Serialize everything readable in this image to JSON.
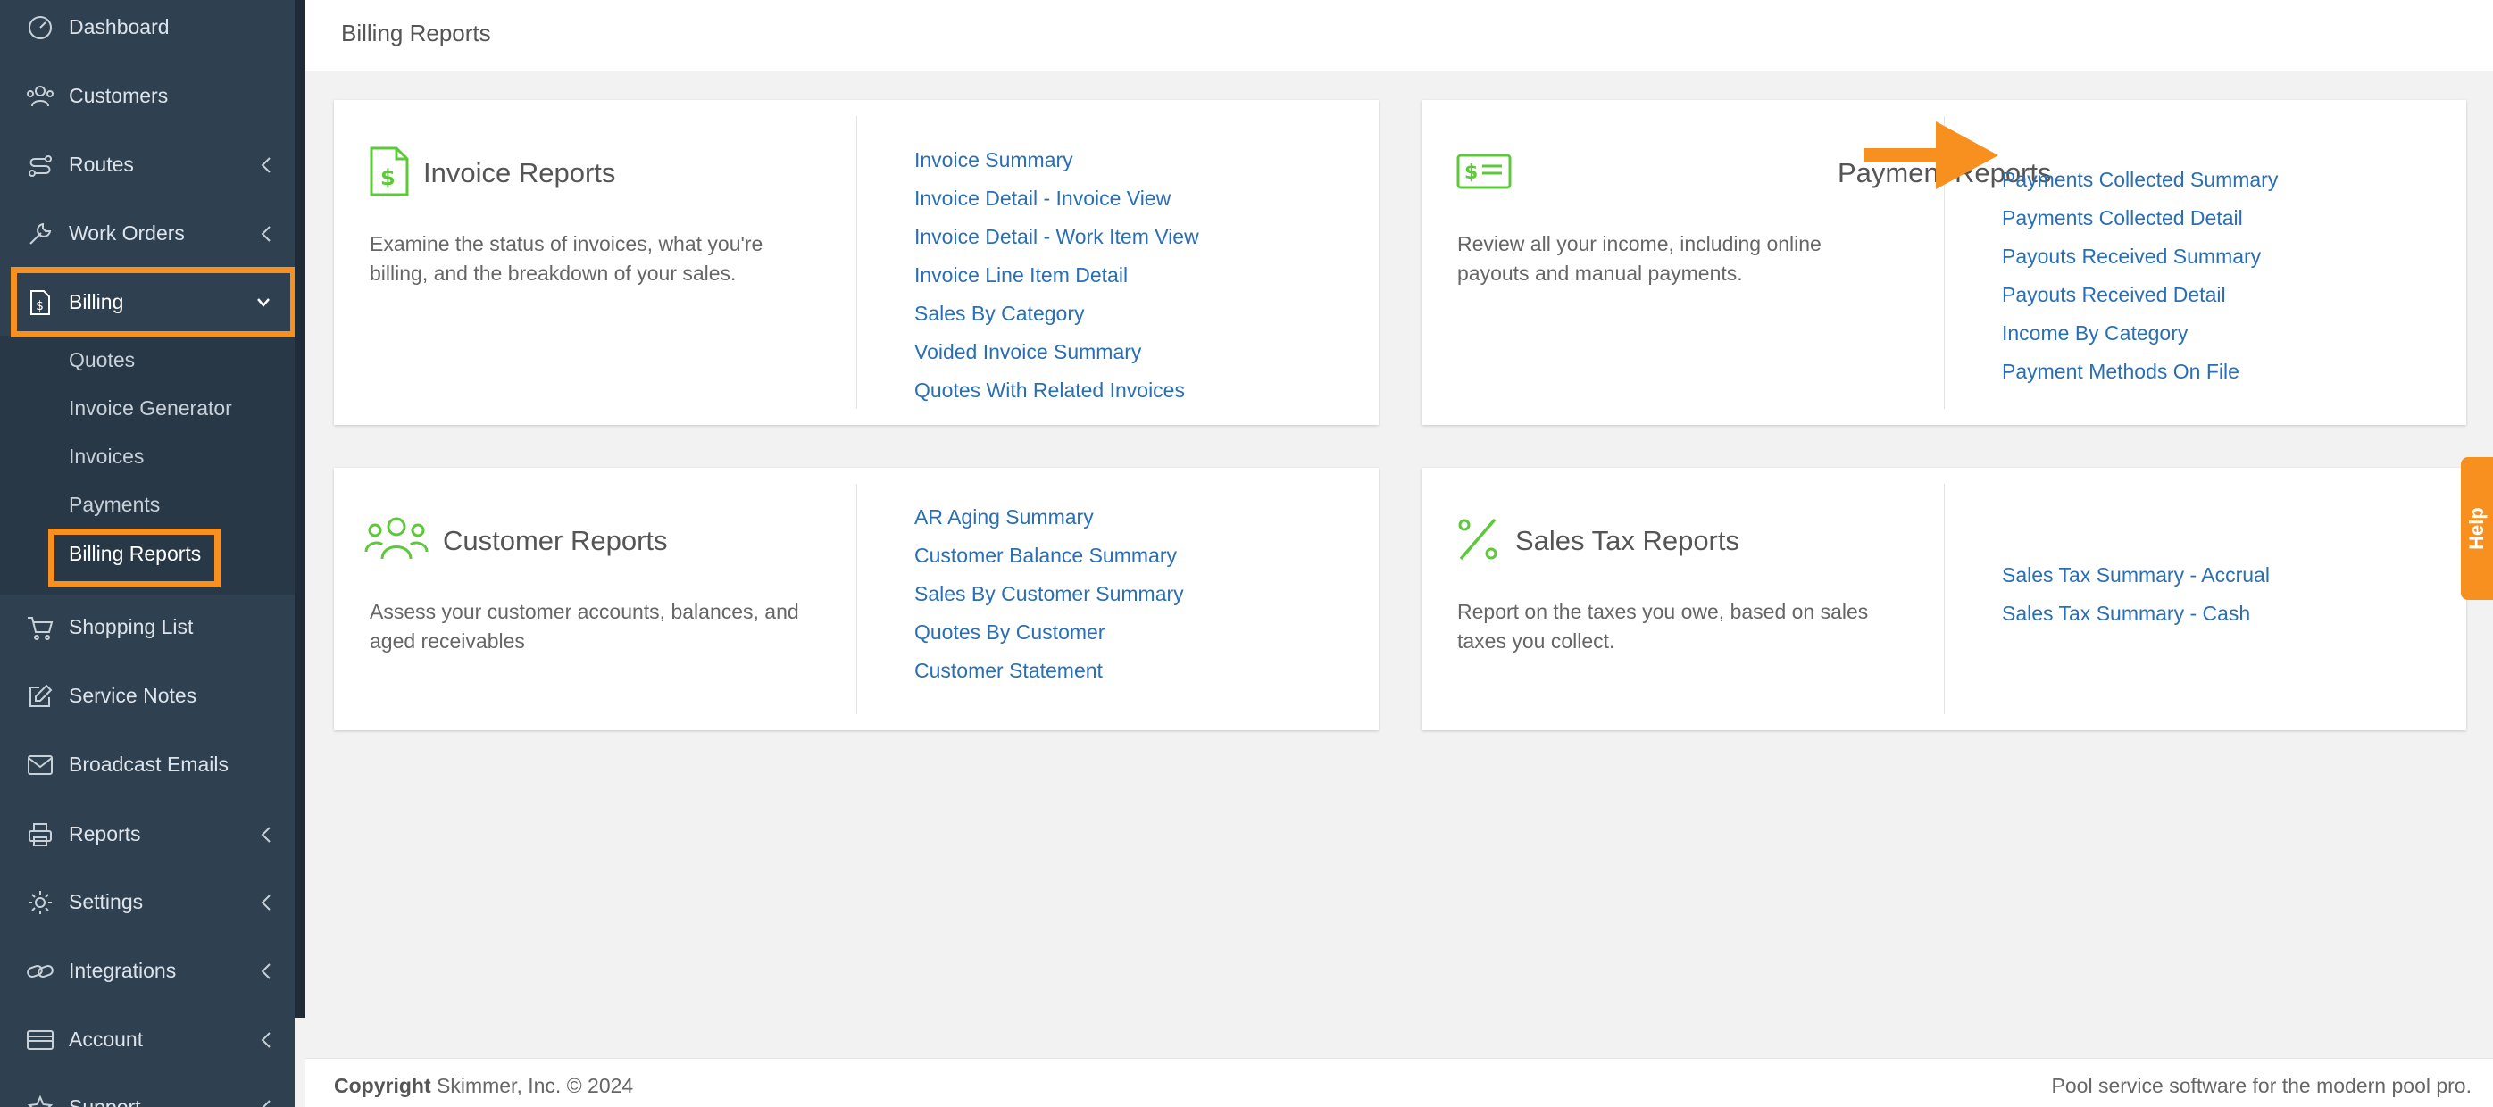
{
  "sidebar": {
    "items": [
      {
        "label": "Dashboard"
      },
      {
        "label": "Customers"
      },
      {
        "label": "Routes"
      },
      {
        "label": "Work Orders"
      },
      {
        "label": "Billing"
      },
      {
        "label": "Shopping List"
      },
      {
        "label": "Service Notes"
      },
      {
        "label": "Broadcast Emails"
      },
      {
        "label": "Reports"
      },
      {
        "label": "Settings"
      },
      {
        "label": "Integrations"
      },
      {
        "label": "Account"
      },
      {
        "label": "Support"
      }
    ],
    "billing_submenu": [
      "Quotes",
      "Invoice Generator",
      "Invoices",
      "Payments",
      "Billing Reports"
    ]
  },
  "header": {
    "title": "Billing Reports"
  },
  "cards": {
    "invoice": {
      "title": "Invoice Reports",
      "description": "Examine the status of invoices, what you're billing, and the breakdown of your sales.",
      "links": [
        "Invoice Summary",
        "Invoice Detail - Invoice View",
        "Invoice Detail - Work Item View",
        "Invoice Line Item Detail",
        "Sales By Category",
        "Voided Invoice Summary",
        "Quotes With Related Invoices"
      ]
    },
    "payment": {
      "title": "Payment Reports",
      "description": "Review all your income, including online payouts and manual payments.",
      "links": [
        "Payments Collected Summary",
        "Payments Collected Detail",
        "Payouts Received Summary",
        "Payouts Received Detail",
        "Income By Category",
        "Payment Methods On File"
      ]
    },
    "customer": {
      "title": "Customer Reports",
      "description": "Assess your customer accounts, balances, and aged receivables",
      "links": [
        "AR Aging Summary",
        "Customer Balance Summary",
        "Sales By Customer Summary",
        "Quotes By Customer",
        "Customer Statement"
      ]
    },
    "salestax": {
      "title": "Sales Tax Reports",
      "description": "Report on the taxes you owe, based on sales taxes you collect.",
      "links": [
        "Sales Tax Summary - Accrual",
        "Sales Tax Summary - Cash"
      ]
    }
  },
  "footer": {
    "copyright_label": "Copyright",
    "copyright_text": " Skimmer, Inc. © 2024",
    "tagline": "Pool service software for the modern pool pro."
  },
  "help": {
    "label": "Help"
  },
  "colors": {
    "accent": "#f7901e",
    "sidebar": "#2f4050",
    "link": "#2a6fb5",
    "icon_green": "#5cc83a"
  }
}
